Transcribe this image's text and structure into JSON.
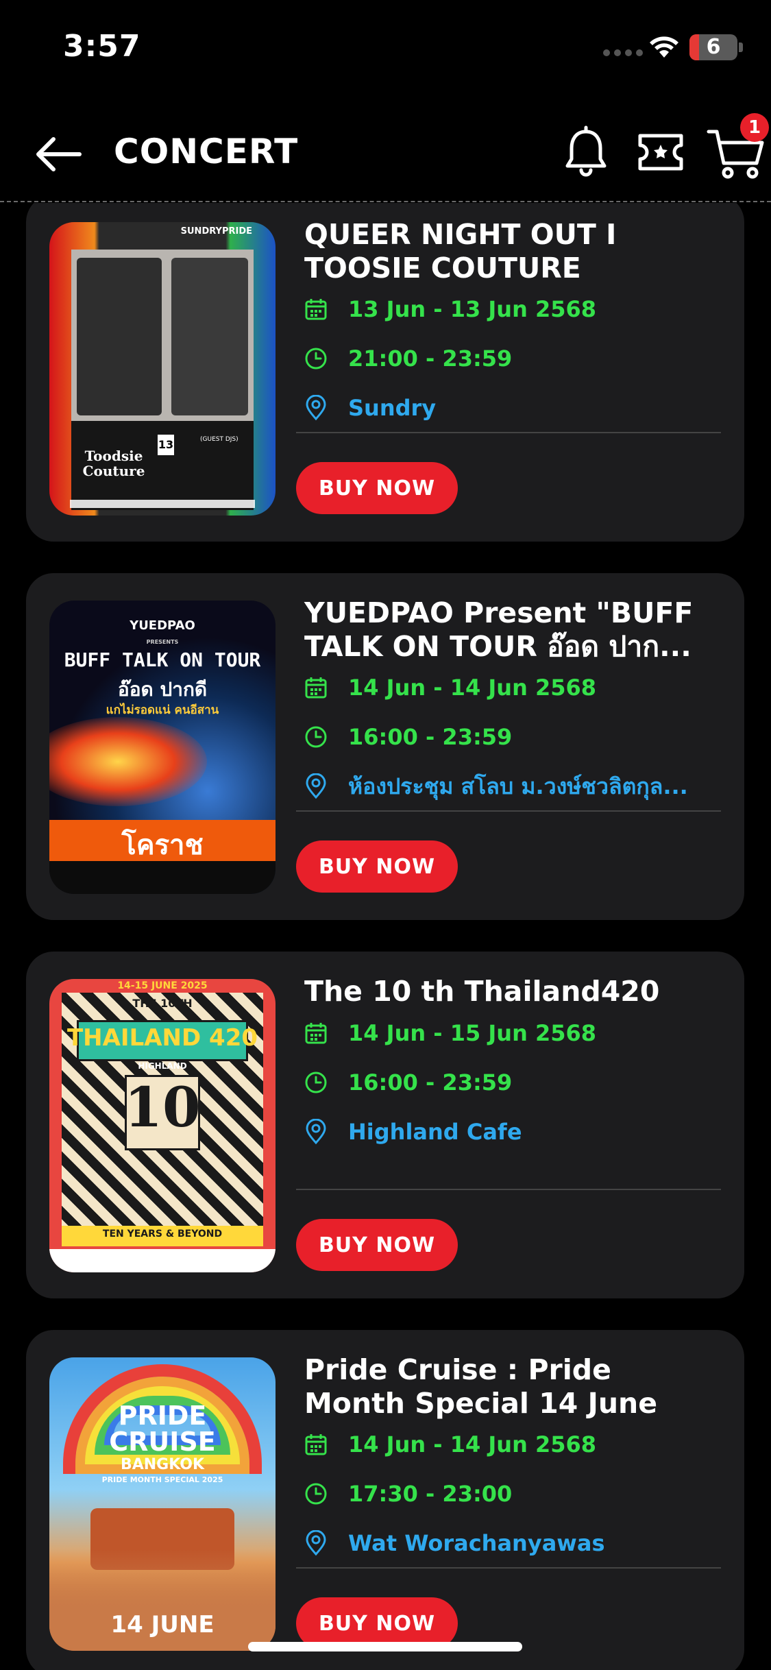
{
  "status": {
    "time": "3:57",
    "battery": "6"
  },
  "nav": {
    "title": "CONCERT",
    "cart_count": "1"
  },
  "events": [
    {
      "title": "QUEER NIGHT OUT I\nTOOSIE COUTURE",
      "date": "13 Jun - 13 Jun 2568",
      "time": "21:00 - 23:59",
      "venue": "Sundry",
      "buy_label": "BUY NOW",
      "poster": {
        "top_text": "SUNDRYPRIDE",
        "name": "Toodsie Couture",
        "day": "13",
        "tag": "(GUEST DJS)"
      }
    },
    {
      "title": "YUEDPAO Present \"BUFF\nTALK ON TOUR อ๊อด ปาก...",
      "date": "14 Jun - 14 Jun 2568",
      "time": "16:00 - 23:59",
      "venue": "ห้องประชุม สโลบ ม.วงษ์ชวลิตกุล...",
      "buy_label": "BUY NOW",
      "poster": {
        "brand": "YUEDPAO",
        "presents": "PRESENTS",
        "headline": "BUFF TALK ON TOUR",
        "thai": "อ๊อด ปากดี",
        "sub": "แกไม่รอดแน่ คนอีสาน",
        "city": "โคราช"
      }
    },
    {
      "title": "The 10 th Thailand420",
      "date": "14 Jun - 15 Jun 2568",
      "time": "16:00 - 23:59",
      "venue": "Highland Cafe",
      "buy_label": "BUY NOW",
      "poster": {
        "dates": "14-15 JUNE 2025",
        "the": "THE 10TH",
        "headline": "THAILAND 420",
        "highland": "HIGHLAND",
        "big": "10",
        "footer": "TEN YEARS & BEYOND"
      }
    },
    {
      "title": "Pride Cruise : Pride\nMonth Special 14 June",
      "date": "14 Jun - 14 Jun 2568",
      "time": "17:30 - 23:00",
      "venue": "Wat Worachanyawas",
      "buy_label": "BUY NOW",
      "poster": {
        "line1": "PRIDE",
        "line2": "CRUISE",
        "line3": "BANGKOK",
        "line4": "PRIDE MONTH SPECIAL 2025",
        "date": "14 JUNE"
      }
    }
  ],
  "colors": {
    "accent_red": "#e8202a",
    "date_green": "#35e24b",
    "venue_blue": "#2fa9ee",
    "card_bg": "#1c1c1e"
  }
}
